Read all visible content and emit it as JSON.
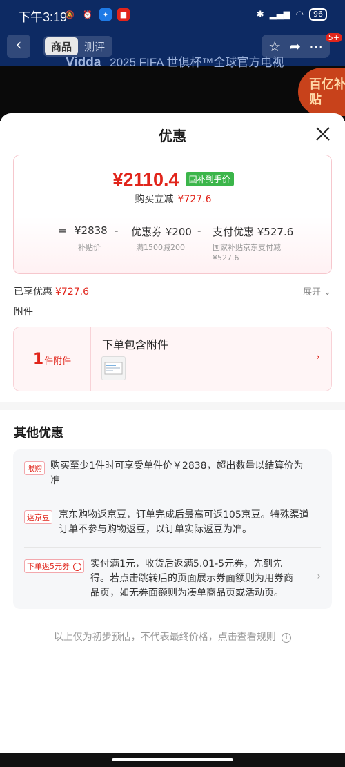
{
  "status_bar": {
    "time": "下午3:19",
    "battery": "96"
  },
  "nav": {
    "tabs": [
      {
        "label": "商品"
      },
      {
        "label": "测评"
      }
    ],
    "badge": "5+"
  },
  "background": {
    "brand": "Vidda",
    "headline": "2025 FIFA 世俱杯™全球官方电视",
    "subsidy": "百亿补贴"
  },
  "sheet": {
    "title": "优惠",
    "price": {
      "currency": "¥",
      "value": "2110.4",
      "tag": "国补到手价",
      "reduce_label": "购买立减",
      "reduce_amount": "¥727.6"
    },
    "formula": {
      "eq": "=",
      "minus": "-",
      "items": [
        {
          "label": "¥2838",
          "sub": "补贴价"
        },
        {
          "label": "优惠券 ¥200",
          "sub": "满1500减200"
        },
        {
          "label": "支付优惠 ¥527.6",
          "sub": "国家补贴京东支付减 ¥527.6"
        }
      ]
    },
    "enjoyed_label": "已享优惠",
    "enjoyed_amount": "¥727.6",
    "expand_label": "展开",
    "attachments_label": "附件",
    "attachment_card": {
      "count": "1",
      "count_label": "件附件",
      "title": "下单包含附件"
    },
    "other_title": "其他优惠",
    "promos": [
      {
        "tag": "限购",
        "text": "购买至少1件时可享受单件价￥2838，超出数量以结算价为准"
      },
      {
        "tag": "返京豆",
        "text": "京东购物返京豆，订单完成后最高可返105京豆。特殊渠道订单不参与购物返豆，以订单实际返豆为准。"
      },
      {
        "tag": "下单返5元券",
        "text": "实付满1元，收货后返满5.01-5元券，先到先得。若点击跳转后的页面展示券面额则为用券商品页，如无券面额则为凑单商品页或活动页。"
      }
    ],
    "disclaimer": "以上仅为初步预估，不代表最终价格，点击查看规则"
  },
  "colors": {
    "accent_red": "#e1251b",
    "green_tag": "#3bb54a",
    "nav_bg": "#0d2a63"
  }
}
